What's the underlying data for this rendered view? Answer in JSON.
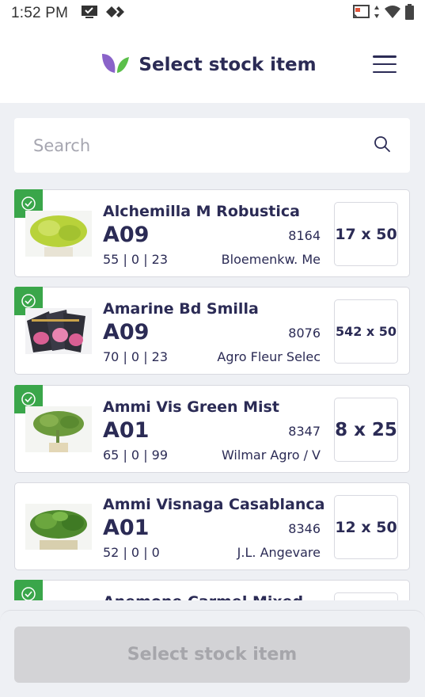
{
  "status_bar": {
    "time": "1:52 PM"
  },
  "header": {
    "title": "Select stock item"
  },
  "search": {
    "placeholder": "Search"
  },
  "items": [
    {
      "name": "Alchemilla M Robustica",
      "code": "A09",
      "number": "8164",
      "qty": "55 | 0 | 23",
      "supplier": "Bloemenkw. Me",
      "pack": "17 x 50",
      "selected": true
    },
    {
      "name": "Amarine Bd Smilla",
      "code": "A09",
      "number": "8076",
      "qty": "70 | 0 | 23",
      "supplier": "Agro Fleur Selec",
      "pack": "542 x 50",
      "selected": true
    },
    {
      "name": "Ammi Vis Green Mist",
      "code": "A01",
      "number": "8347",
      "qty": "65 | 0 | 99",
      "supplier": "Wilmar Agro / V",
      "pack": "8 x 25",
      "selected": true
    },
    {
      "name": "Ammi Visnaga Casablanca",
      "code": "A01",
      "number": "8346",
      "qty": "52 | 0 | 0",
      "supplier": "J.L. Angevare",
      "pack": "12 x 50",
      "selected": false
    },
    {
      "name": "Anemone Carmel Mixed",
      "selected": true
    }
  ],
  "footer": {
    "select_label": "Select stock item"
  },
  "colors": {
    "brand_dark": "#2b2b55",
    "brand_purple": "#8a63c9",
    "brand_green": "#5bbf4a",
    "check_green": "#3aa64a",
    "disabled_bg": "#d3d3d6"
  }
}
